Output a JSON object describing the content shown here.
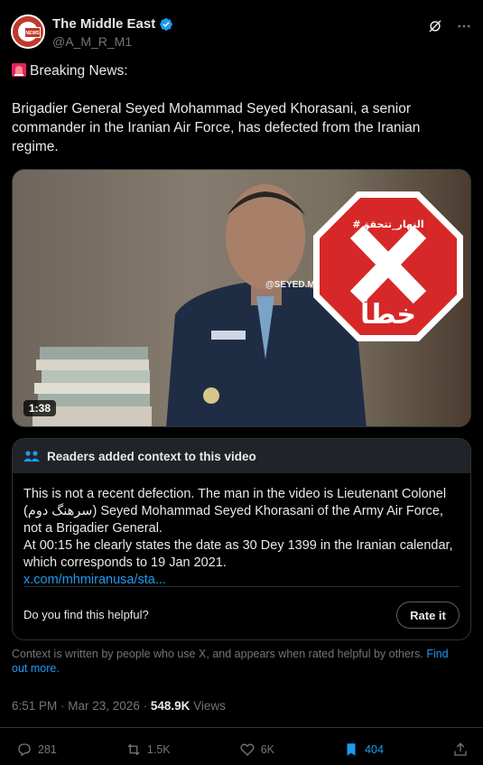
{
  "account": {
    "name": "The Middle East",
    "handle": "@A_M_R_M1",
    "avatar_text": "NEWS"
  },
  "tweet": {
    "breaking": "Breaking News:",
    "body": "Brigadier General Seyed Mohammad Seyed Khorasani, a senior commander in the Iranian Air Force, has defected from the Iranian regime."
  },
  "media": {
    "duration": "1:38",
    "watermark": "@SEYED.MO",
    "stamp_top": "#النهار_تتحقق",
    "stamp_bottom": "خطأ"
  },
  "community_note": {
    "title": "Readers added context to this video",
    "line1": "This is not a recent defection. The man in the video is Lieutenant Colonel (سرهنگ دوم) Seyed Mohammad Seyed Khorasani of the Army Air Force, not a Brigadier General.",
    "line2": "At 00:15 he clearly states the date as 30 Dey 1399 in the Iranian calendar, which corresponds to 19 Jan 2021.",
    "link": "x.com/mhmiranusa/sta...",
    "helpful_q": "Do you find this helpful?",
    "rate_label": "Rate it"
  },
  "context_footer": {
    "text": "Context is written by people who use X, and appears when rated helpful by others. ",
    "link": "Find out more."
  },
  "meta": {
    "time": "6:51 PM · Mar 23, 2026 · ",
    "views_count": "548.9K",
    "views_label": " Views"
  },
  "actions": {
    "replies": "281",
    "reposts": "1.5K",
    "likes": "6K",
    "bookmarks": "404"
  },
  "colors": {
    "accent": "#1d9bf0",
    "muted": "#71767b",
    "stop_red": "#d62828"
  }
}
